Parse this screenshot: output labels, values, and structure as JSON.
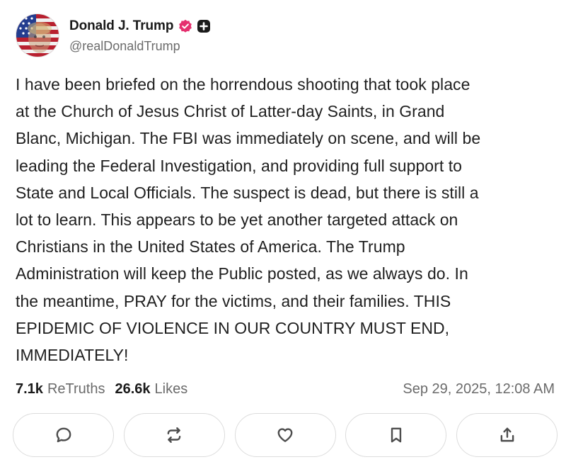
{
  "author": {
    "display_name": "Donald J. Trump",
    "handle": "@realDonaldTrump",
    "verified_icon": "verified-badge-icon",
    "badge_icon": "plus-badge-icon"
  },
  "post": {
    "lines": [
      "I have been briefed on the horrendous shooting that took place",
      "at the Church of Jesus Christ of Latter-day Saints, in Grand",
      "Blanc, Michigan. The FBI was immediately on scene, and will be",
      "leading the Federal Investigation, and providing full support to",
      "State and Local Officials. The suspect is dead, but there is still a",
      "lot to learn. This appears to be yet another targeted attack on",
      "Christians in the United States of America. The Trump",
      "Administration will keep the Public posted, as we always do. In",
      "the meantime, PRAY for the victims, and their families. THIS",
      "EPIDEMIC OF VIOLENCE IN OUR COUNTRY MUST END,",
      "IMMEDIATELY!"
    ]
  },
  "stats": {
    "retruths_count": "7.1k",
    "retruths_label": "ReTruths",
    "likes_count": "26.6k",
    "likes_label": "Likes",
    "timestamp": "Sep 29, 2025, 12:08 AM"
  },
  "actions": [
    {
      "name": "reply-button",
      "icon": "comment-icon"
    },
    {
      "name": "retruth-button",
      "icon": "repost-icon"
    },
    {
      "name": "like-button",
      "icon": "heart-icon"
    },
    {
      "name": "bookmark-button",
      "icon": "bookmark-icon"
    },
    {
      "name": "share-button",
      "icon": "share-icon"
    }
  ],
  "colors": {
    "verified_badge": "#e5306f",
    "text": "#1f1f1f",
    "muted": "#6b6b6b",
    "border": "#dcdcdc"
  }
}
